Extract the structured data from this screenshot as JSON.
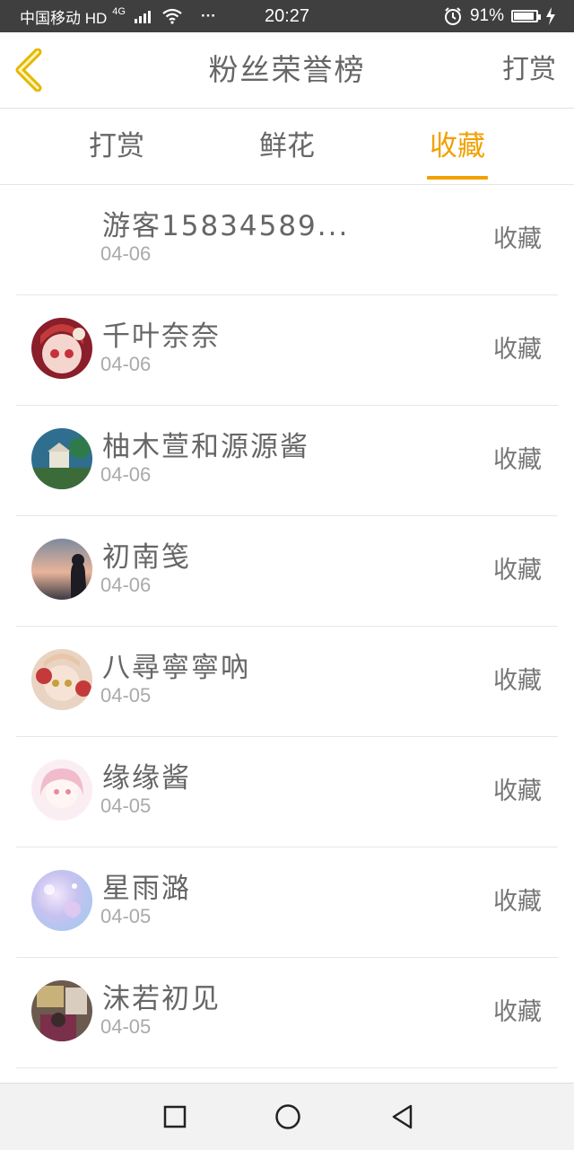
{
  "status_bar": {
    "carrier": "中国移动 HD",
    "network": "4G",
    "menu_dots": "···",
    "time": "20:27",
    "battery_percent": "91%",
    "battery_level": 0.91
  },
  "header": {
    "title": "粉丝荣誉榜",
    "action_label": "打赏"
  },
  "tabs": [
    {
      "label": "打赏",
      "active": false
    },
    {
      "label": "鲜花",
      "active": false
    },
    {
      "label": "收藏",
      "active": true
    }
  ],
  "colors": {
    "accent": "#f2a000",
    "status_bar_bg": "#3f3f3f"
  },
  "list": [
    {
      "name": "游客15834589...",
      "date": "04-06",
      "action": "收藏",
      "avatar": "none"
    },
    {
      "name": "千叶奈奈",
      "date": "04-06",
      "action": "收藏",
      "avatar": "anime-girl-red"
    },
    {
      "name": "柚木萱和源源酱",
      "date": "04-06",
      "action": "收藏",
      "avatar": "landscape-house"
    },
    {
      "name": "初南笺",
      "date": "04-06",
      "action": "收藏",
      "avatar": "sunset-silhouette"
    },
    {
      "name": "八尋寧寧吶",
      "date": "04-05",
      "action": "收藏",
      "avatar": "anime-girl-flowers"
    },
    {
      "name": "缘缘酱",
      "date": "04-05",
      "action": "收藏",
      "avatar": "anime-girl-pink"
    },
    {
      "name": "星雨潞",
      "date": "04-05",
      "action": "收藏",
      "avatar": "pastel-galaxy"
    },
    {
      "name": "沫若初见",
      "date": "04-05",
      "action": "收藏",
      "avatar": "room-photo"
    }
  ],
  "navbar": {
    "icons": [
      "recent-apps-icon",
      "home-icon",
      "back-icon"
    ]
  }
}
